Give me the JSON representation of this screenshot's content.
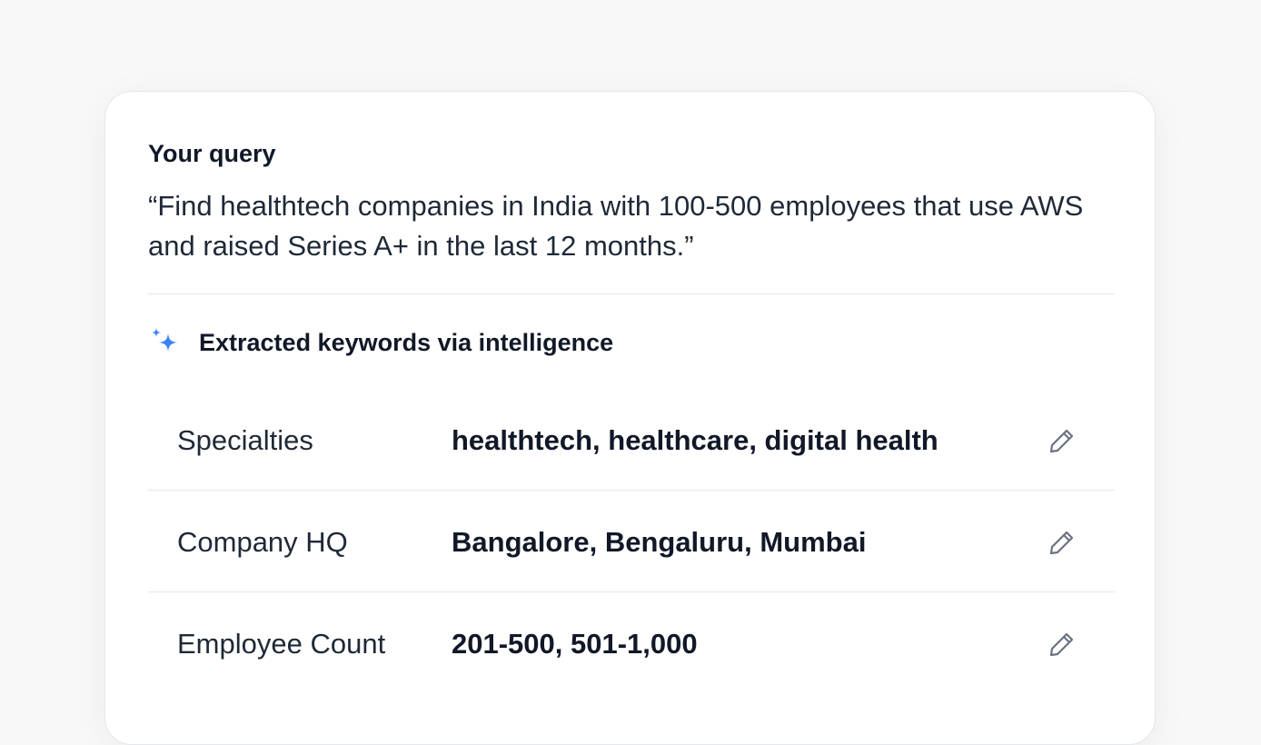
{
  "query": {
    "label": "Your query",
    "text": "“Find healthtech companies in India with 100-500 employees that use AWS and raised Series A+ in the last 12 months.”"
  },
  "extracted": {
    "title": "Extracted keywords via intelligence",
    "icon": "sparkle-icon",
    "icon_color": "#3b82f6",
    "rows": [
      {
        "label": "Specialties",
        "value": "healthtech, healthcare, digital health",
        "edit_icon": "pencil-icon"
      },
      {
        "label": "Company HQ",
        "value": "Bangalore, Bengaluru, Mumbai",
        "edit_icon": "pencil-icon"
      },
      {
        "label": "Employee Count",
        "value": "201-500, 501-1,000",
        "edit_icon": "pencil-icon"
      }
    ]
  }
}
